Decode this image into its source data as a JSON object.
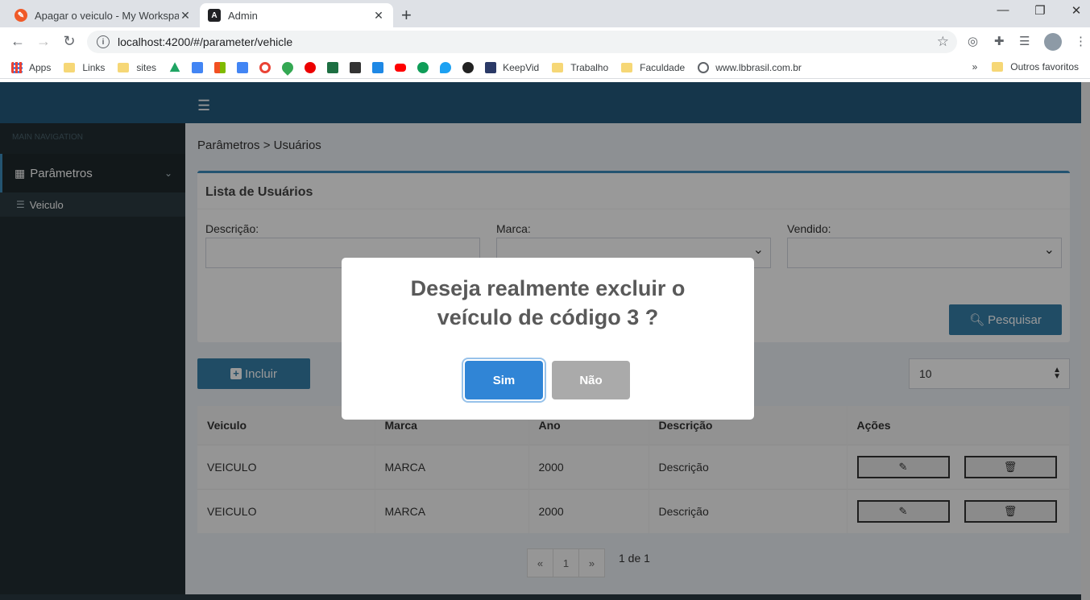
{
  "browser": {
    "tabs": [
      {
        "title": "Apagar o veiculo - My Workspace",
        "favicon_color": "#f05a28"
      },
      {
        "title": "Admin",
        "favicon_color": "#202124"
      }
    ],
    "url": "localhost:4200/#/parameter/vehicle",
    "bookmarks": [
      {
        "label": "Apps",
        "kind": "apps-grid"
      },
      {
        "label": "Links",
        "kind": "folder"
      },
      {
        "label": "sites",
        "kind": "folder"
      },
      {
        "label": "",
        "kind": "google-drive-icon",
        "color": "#1fa463"
      },
      {
        "label": "",
        "kind": "calendar-icon",
        "color": "#4285f4"
      },
      {
        "label": "",
        "kind": "microsoft-icon",
        "color": "#f25022"
      },
      {
        "label": "",
        "kind": "translate-icon",
        "color": "#4285f4"
      },
      {
        "label": "",
        "kind": "google-icon",
        "color": "#ea4335"
      },
      {
        "label": "",
        "kind": "maps-icon",
        "color": "#34a853"
      },
      {
        "label": "",
        "kind": "santander-icon",
        "color": "#ec0000"
      },
      {
        "label": "",
        "kind": "excel-icon",
        "color": "#1d6f42"
      },
      {
        "label": "",
        "kind": "xd-icon",
        "color": "#333333"
      },
      {
        "label": "",
        "kind": "g-icon",
        "color": "#1e88e5"
      },
      {
        "label": "",
        "kind": "youtube-icon",
        "color": "#ff0000"
      },
      {
        "label": "",
        "kind": "number-icon",
        "color": "#0f9d58"
      },
      {
        "label": "",
        "kind": "twitter-icon",
        "color": "#1da1f2"
      },
      {
        "label": "",
        "kind": "linkedin-icon",
        "color": "#222222"
      },
      {
        "label": "KeepVid",
        "kind": "keepvid-icon",
        "color": "#2b3a67"
      },
      {
        "label": "Trabalho",
        "kind": "folder"
      },
      {
        "label": "Faculdade",
        "kind": "folder"
      },
      {
        "label": "www.lbbrasil.com.br",
        "kind": "globe-icon",
        "color": "#5f6368"
      }
    ],
    "more_label": "»",
    "other_bookmarks": "Outros favoritos"
  },
  "sidebar": {
    "nav_header": "MAIN NAVIGATION",
    "menu_label": "Parâmetros",
    "submenu_label": "Veiculo"
  },
  "content": {
    "breadcrumb": "Parâmetros > Usuários",
    "box_title": "Lista de Usuários",
    "filters": {
      "descricao_label": "Descrição:",
      "marca_label": "Marca:",
      "vendido_label": "Vendido:"
    },
    "search_label": "Pesquisar",
    "add_label": "Incluir",
    "page_size": "10",
    "table": {
      "headers": [
        "Veiculo",
        "Marca",
        "Ano",
        "Descrição",
        "Ações"
      ],
      "rows": [
        [
          "VEICULO",
          "MARCA",
          "2000",
          "Descrição"
        ],
        [
          "VEICULO",
          "MARCA",
          "2000",
          "Descrição"
        ]
      ]
    },
    "pager": {
      "prev": "«",
      "page": "1",
      "next": "»",
      "info": "1 de 1"
    }
  },
  "modal": {
    "title": "Deseja realmente excluir o veículo de código 3 ?",
    "confirm_label": "Sim",
    "cancel_label": "Não",
    "confirm_color": "#3085d6",
    "cancel_color": "#aaaaaa"
  },
  "colors": {
    "header": "#235a7e",
    "sidebar": "#222d32",
    "primary_button": "#367fa9"
  }
}
